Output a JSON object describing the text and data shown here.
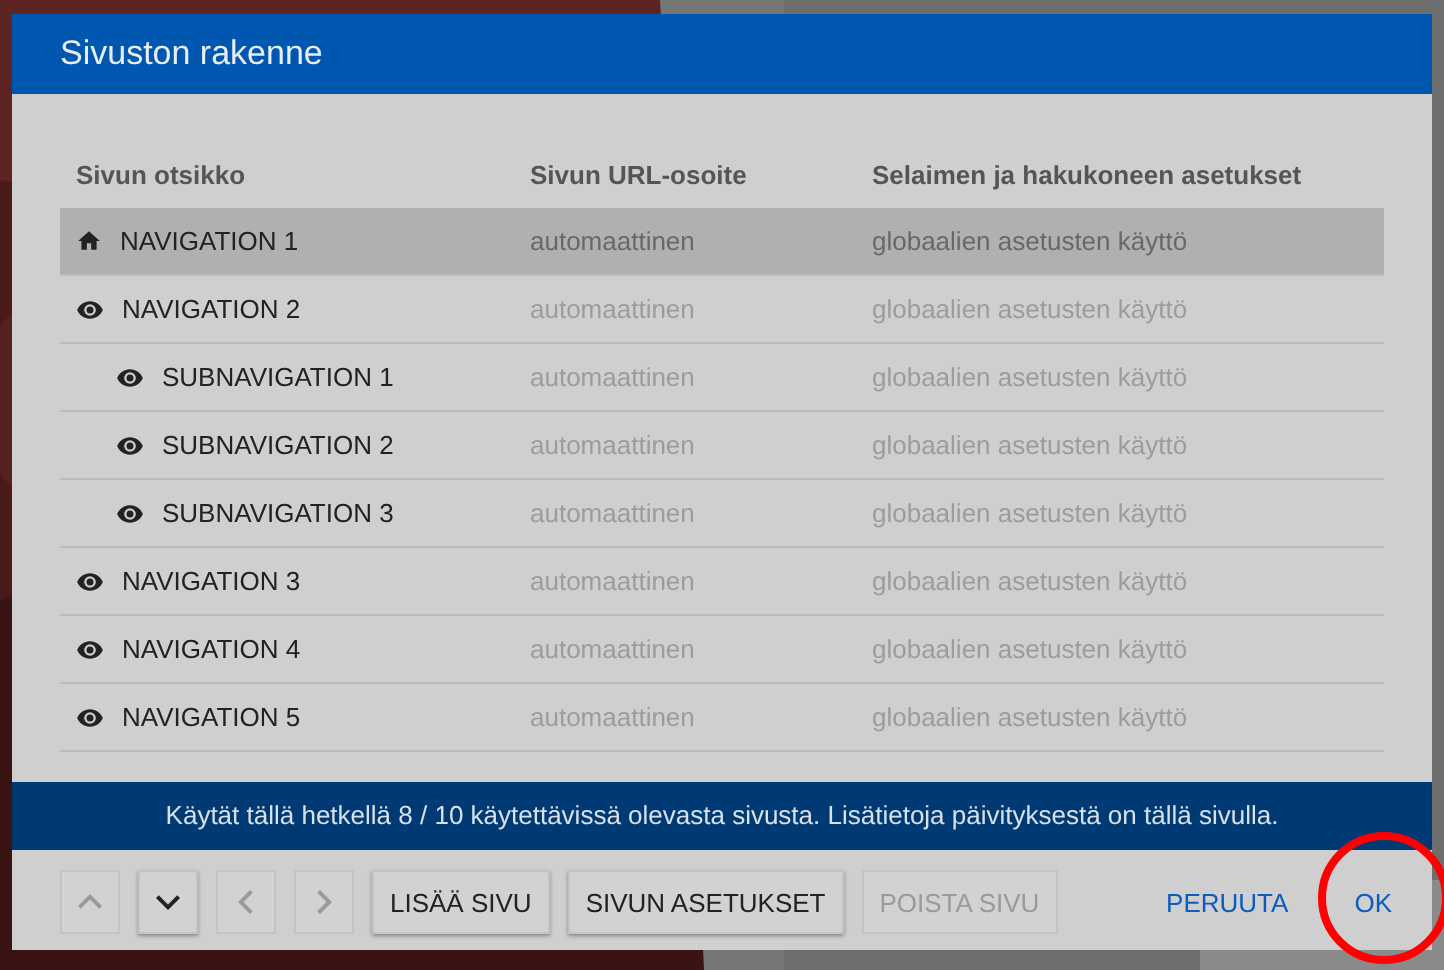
{
  "dialog": {
    "title": "Sivuston rakenne"
  },
  "table": {
    "columns": [
      "Sivun otsikko",
      "Sivun URL-osoite",
      "Selaimen ja hakukoneen asetukset"
    ],
    "rows": [
      {
        "kind": "home",
        "title": "NAVIGATION 1",
        "url": "automaattinen",
        "settings": "globaalien asetusten käyttö",
        "selected": true
      },
      {
        "kind": "eye",
        "title": "NAVIGATION 2",
        "url": "automaattinen",
        "settings": "globaalien asetusten käyttö",
        "selected": false,
        "children": [
          {
            "kind": "eye",
            "title": "SUBNAVIGATION 1",
            "url": "automaattinen",
            "settings": "globaalien asetusten käyttö",
            "selected": false
          },
          {
            "kind": "eye",
            "title": "SUBNAVIGATION 2",
            "url": "automaattinen",
            "settings": "globaalien asetusten käyttö",
            "selected": false
          },
          {
            "kind": "eye",
            "title": "SUBNAVIGATION 3",
            "url": "automaattinen",
            "settings": "globaalien asetusten käyttö",
            "selected": false
          }
        ]
      },
      {
        "kind": "eye",
        "title": "NAVIGATION 3",
        "url": "automaattinen",
        "settings": "globaalien asetusten käyttö",
        "selected": false
      },
      {
        "kind": "eye",
        "title": "NAVIGATION 4",
        "url": "automaattinen",
        "settings": "globaalien asetusten käyttö",
        "selected": false
      },
      {
        "kind": "eye",
        "title": "NAVIGATION 5",
        "url": "automaattinen",
        "settings": "globaalien asetusten käyttö",
        "selected": false
      }
    ]
  },
  "info_bar": "Käytät tällä hetkellä 8 / 10 käytettävissä olevasta sivusta. Lisätietoja päivityksestä on tällä sivulla.",
  "toolbar": [
    {
      "kind": "up",
      "disabled": true
    },
    {
      "kind": "down",
      "disabled": false
    },
    {
      "kind": "left",
      "disabled": true
    },
    {
      "kind": "right",
      "disabled": true
    },
    {
      "kind": "text",
      "label": "LISÄÄ SIVU",
      "disabled": false
    },
    {
      "kind": "text",
      "label": "SIVUN ASETUKSET",
      "disabled": false
    },
    {
      "kind": "text",
      "label": "POISTA SIVU",
      "disabled": true
    }
  ],
  "actions": [
    {
      "label": "PERUUTA",
      "highlighted": false
    },
    {
      "label": "OK",
      "highlighted": true
    }
  ]
}
